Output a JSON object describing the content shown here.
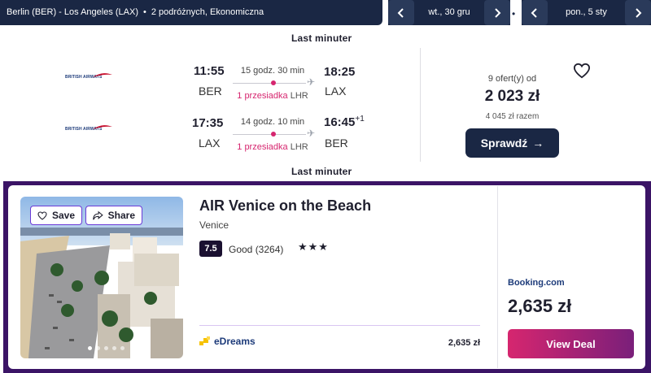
{
  "search": {
    "route": "Berlin (BER) - Los Angeles (LAX)",
    "separator": "•",
    "passengers": "2 podróżnych, Ekonomiczna",
    "outbound_date": "wt., 30 gru",
    "return_date": "pon., 5 sty",
    "dot": "•"
  },
  "flight": {
    "provider_top": "Last minuter",
    "provider_bottom": "Last minuter",
    "airline_logo_text": "BRITISH AIRWAYS",
    "legs": [
      {
        "depart_time": "11:55",
        "depart_airport": "BER",
        "duration": "15 godz. 30 min",
        "stops": "1 przesiadka",
        "stop_code": "LHR",
        "arrive_time": "18:25",
        "arrive_airport": "LAX",
        "day_offset": ""
      },
      {
        "depart_time": "17:35",
        "depart_airport": "LAX",
        "duration": "14 godz. 10 min",
        "stops": "1 przesiadka",
        "stop_code": "LHR",
        "arrive_time": "16:45",
        "arrive_airport": "BER",
        "day_offset": "+1"
      }
    ],
    "offers": "9 ofert(y) od",
    "price": "2 023 zł",
    "total": "4 045 zł razem",
    "check_button": "Sprawdź",
    "arrow": "→"
  },
  "hotel": {
    "save_label": "Save",
    "share_label": "Share",
    "name": "AIR Venice on the Beach",
    "city": "Venice",
    "rating": "7.5",
    "rating_text": "Good (3264)",
    "stars": "★★★",
    "alt_provider": "eDreams",
    "alt_price": "2,635 zł",
    "provider": "Booking.com",
    "price": "2,635 zł",
    "deal_button": "View Deal",
    "photo_count": 5,
    "photo_active": 0
  },
  "colors": {
    "navy": "#1a2744",
    "accent_pink": "#d6266f",
    "purple_frame": "#3b1466"
  }
}
